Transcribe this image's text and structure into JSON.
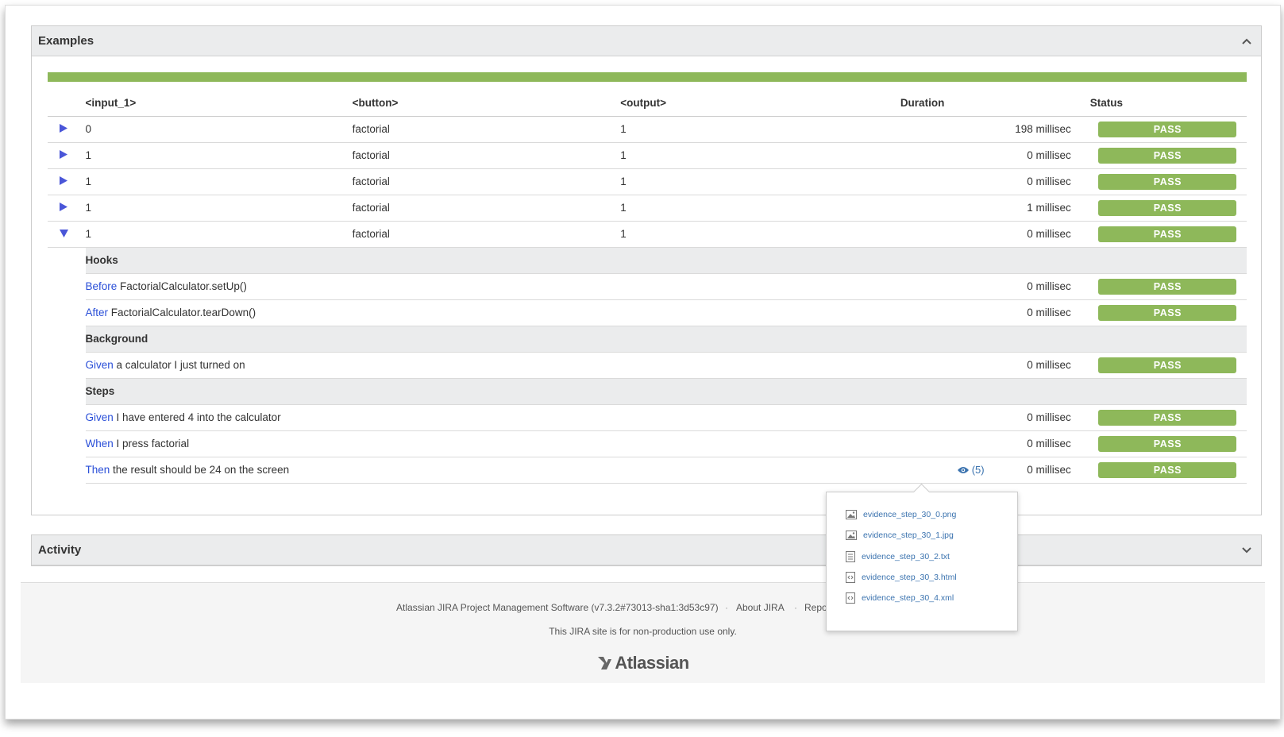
{
  "examples": {
    "title": "Examples",
    "columns": {
      "input": "<input_1>",
      "button": "<button>",
      "output": "<output>",
      "duration": "Duration",
      "status": "Status"
    },
    "rows": [
      {
        "input": "0",
        "button": "factorial",
        "output": "1",
        "duration": "198 millisec",
        "status": "PASS"
      },
      {
        "input": "1",
        "button": "factorial",
        "output": "1",
        "duration": "0 millisec",
        "status": "PASS"
      },
      {
        "input": "1",
        "button": "factorial",
        "output": "1",
        "duration": "0 millisec",
        "status": "PASS"
      },
      {
        "input": "1",
        "button": "factorial",
        "output": "1",
        "duration": "1 millisec",
        "status": "PASS"
      },
      {
        "input": "1",
        "button": "factorial",
        "output": "1",
        "duration": "0 millisec",
        "status": "PASS"
      }
    ],
    "hooks": {
      "title": "Hooks",
      "items": [
        {
          "keyword": "Before",
          "text": " FactorialCalculator.setUp()",
          "duration": "0 millisec",
          "status": "PASS"
        },
        {
          "keyword": "After",
          "text": " FactorialCalculator.tearDown()",
          "duration": "0 millisec",
          "status": "PASS"
        }
      ]
    },
    "background": {
      "title": "Background",
      "items": [
        {
          "keyword": "Given",
          "text": " a calculator I just turned on",
          "duration": "0 millisec",
          "status": "PASS"
        }
      ]
    },
    "steps": {
      "title": "Steps",
      "items": [
        {
          "keyword": "Given",
          "text": " I have entered 4 into the calculator",
          "duration": "0 millisec",
          "status": "PASS"
        },
        {
          "keyword": "When",
          "text": " I press factorial",
          "duration": "0 millisec",
          "status": "PASS"
        },
        {
          "keyword": "Then",
          "text": " the result should be 24 on the screen",
          "duration": "0 millisec",
          "status": "PASS",
          "evidence_count": "(5)"
        }
      ]
    }
  },
  "evidence_popup": {
    "files": [
      {
        "name": "evidence_step_30_0.png",
        "icon": "image-file-icon"
      },
      {
        "name": "evidence_step_30_1.jpg",
        "icon": "image-file-icon"
      },
      {
        "name": "evidence_step_30_2.txt",
        "icon": "text-file-icon"
      },
      {
        "name": "evidence_step_30_3.html",
        "icon": "code-file-icon"
      },
      {
        "name": "evidence_step_30_4.xml",
        "icon": "code-file-icon"
      }
    ]
  },
  "activity": {
    "title": "Activity"
  },
  "footer": {
    "software": "Atlassian JIRA Project Management Software (v7.3.2#73013-sha1:3d53c97)",
    "sep": "·",
    "about": "About JIRA",
    "report": "Report a",
    "notice": "This JIRA site is for non-production use only.",
    "logo": "Atlassian"
  },
  "colors": {
    "pass": "#8eb85a",
    "link": "#2a4fd8",
    "header_bg": "#ebeced"
  }
}
